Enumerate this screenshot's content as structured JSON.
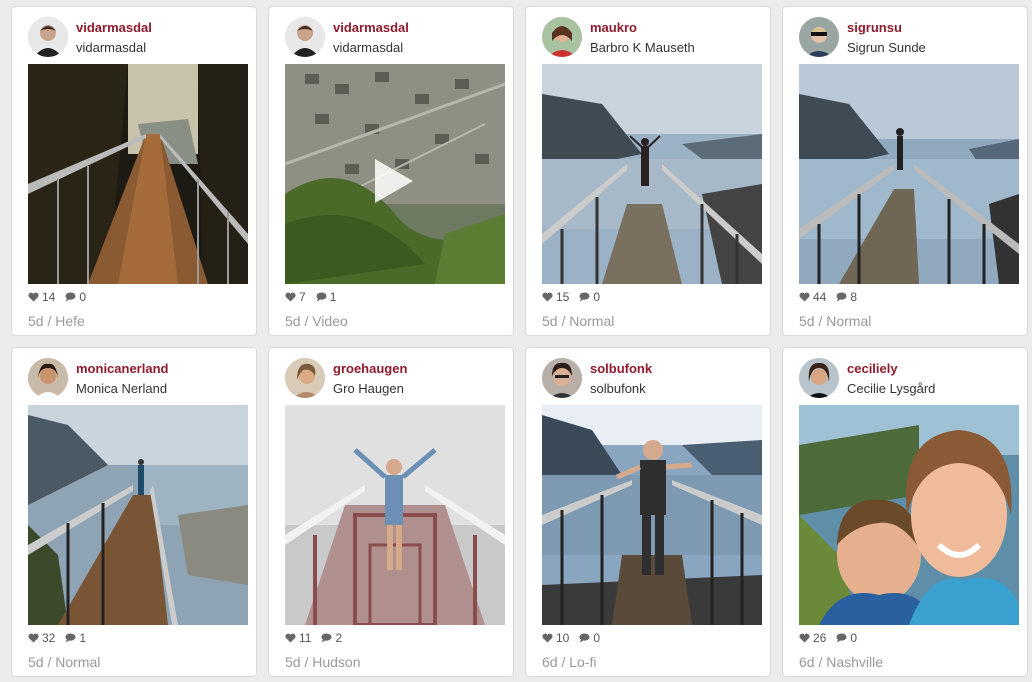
{
  "posts": [
    {
      "username": "vidarmasdal",
      "fullname": "vidarmasdal",
      "likes": "14",
      "comments": "0",
      "meta": "5d / Hefe",
      "type": "photo"
    },
    {
      "username": "vidarmasdal",
      "fullname": "vidarmasdal",
      "likes": "7",
      "comments": "1",
      "meta": "5d / Video",
      "type": "video"
    },
    {
      "username": "maukro",
      "fullname": "Barbro K Mauseth",
      "likes": "15",
      "comments": "0",
      "meta": "5d / Normal",
      "type": "photo"
    },
    {
      "username": "sigrunsu",
      "fullname": "Sigrun Sunde",
      "likes": "44",
      "comments": "8",
      "meta": "5d / Normal",
      "type": "photo"
    },
    {
      "username": "monicanerland",
      "fullname": "Monica Nerland",
      "likes": "32",
      "comments": "1",
      "meta": "5d / Normal",
      "type": "photo"
    },
    {
      "username": "groehaugen",
      "fullname": "Gro Haugen",
      "likes": "11",
      "comments": "2",
      "meta": "5d / Hudson",
      "type": "photo"
    },
    {
      "username": "solbufonk",
      "fullname": "solbufonk",
      "likes": "10",
      "comments": "0",
      "meta": "6d / Lo-fi",
      "type": "photo"
    },
    {
      "username": "ceciliely",
      "fullname": "Cecilie Lysgård",
      "likes": "26",
      "comments": "0",
      "meta": "6d / Nashville",
      "type": "photo"
    }
  ],
  "icons": {
    "like": "heart-icon",
    "comment": "speech-bubble-icon",
    "play": "play-icon"
  },
  "colors": {
    "username": "#8e1b2e",
    "meta": "#9a9a9a",
    "background": "#ececec"
  }
}
